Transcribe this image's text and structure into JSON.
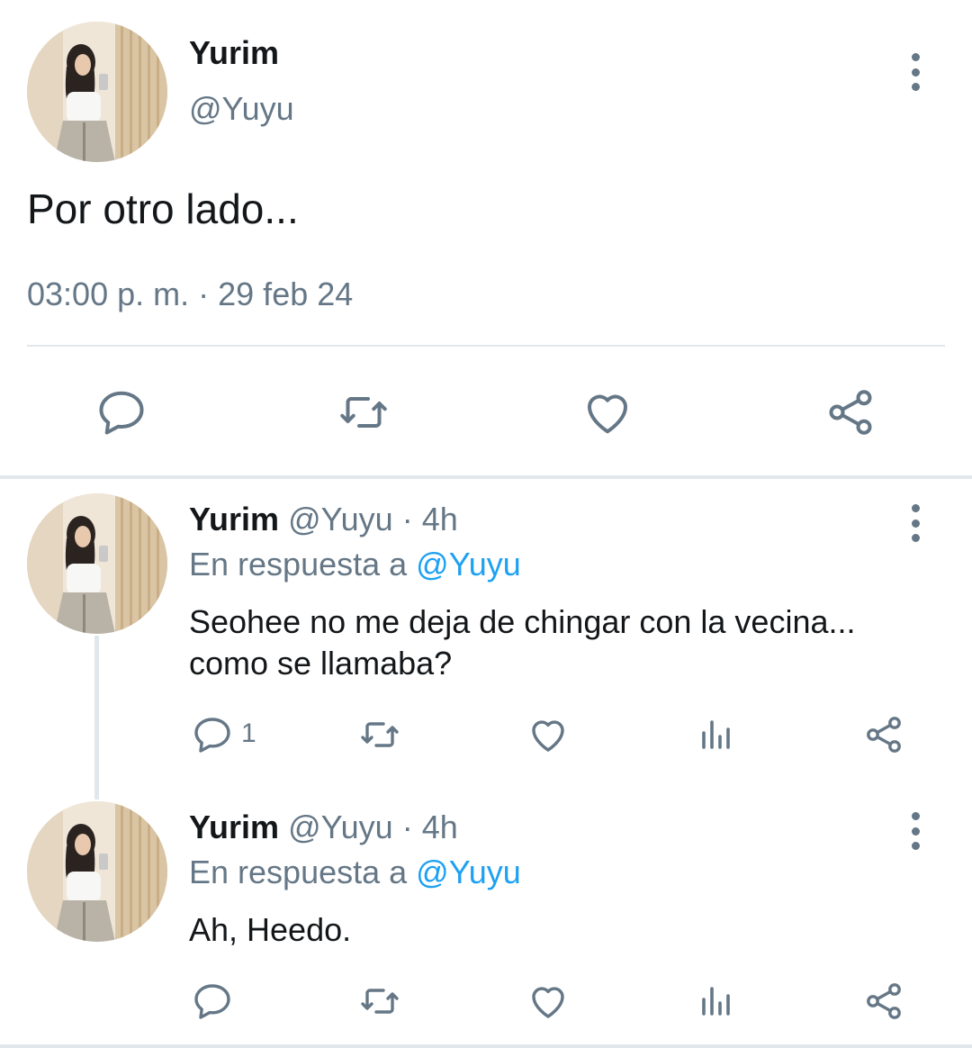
{
  "main_tweet": {
    "name": "Yurim",
    "handle": "@Yuyu",
    "text": "Por otro lado...",
    "time": "03:00 p. m.",
    "separator": "·",
    "date": "29 feb 24"
  },
  "replies": [
    {
      "name": "Yurim",
      "handle": "@Yuyu",
      "dot": "·",
      "age": "4h",
      "reply_prefix": "En respuesta a",
      "reply_to": "@Yuyu",
      "text_line1": "Seohee no me deja de chingar con la vecina...",
      "text_line2": "como se llamaba?",
      "reply_count": "1"
    },
    {
      "name": "Yurim",
      "handle": "@Yuyu",
      "dot": "·",
      "age": "4h",
      "reply_prefix": "En respuesta a",
      "reply_to": "@Yuyu",
      "text_line1": "Ah, Heedo.",
      "reply_count": ""
    }
  ],
  "icons": {
    "reply": "speech-bubble-icon",
    "retweet": "retweet-arrows-icon",
    "like": "heart-icon",
    "analytics": "bar-chart-icon",
    "share": "share-nodes-icon",
    "more": "vertical-dots-icon"
  },
  "colors": {
    "text": "#14171a",
    "muted": "#657786",
    "link": "#1da1f2",
    "divider": "#e1e8ed"
  }
}
